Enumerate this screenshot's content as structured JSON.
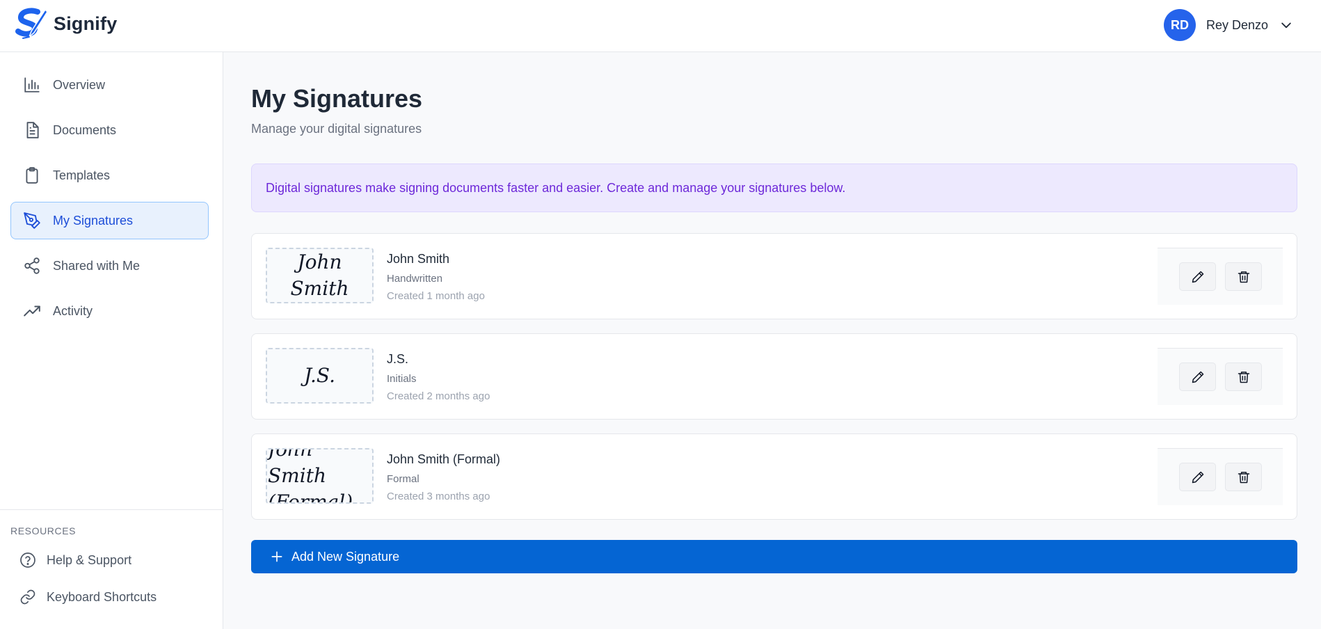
{
  "app": {
    "name": "Signify",
    "brand_color": "#1d63ed"
  },
  "user": {
    "initials": "RD",
    "name": "Rey Denzo"
  },
  "sidebar": {
    "items": [
      {
        "label": "Overview",
        "icon": "bar-chart-icon"
      },
      {
        "label": "Documents",
        "icon": "document-icon"
      },
      {
        "label": "Templates",
        "icon": "clipboard-icon"
      },
      {
        "label": "My Signatures",
        "icon": "pen-tool-icon",
        "active": true
      },
      {
        "label": "Shared with Me",
        "icon": "share-icon"
      },
      {
        "label": "Activity",
        "icon": "trending-up-icon"
      }
    ],
    "resources_label": "RESOURCES",
    "resources": [
      {
        "label": "Help & Support",
        "icon": "help-circle-icon"
      },
      {
        "label": "Keyboard Shortcuts",
        "icon": "link-icon"
      }
    ]
  },
  "main": {
    "title": "My Signatures",
    "subtitle": "Manage your digital signatures",
    "banner": "Digital signatures make signing documents faster and easier. Create and manage your signatures below.",
    "signatures": [
      {
        "preview": "John Smith",
        "name": "John Smith",
        "type": "Handwritten",
        "created": "Created 1 month ago"
      },
      {
        "preview": "J.S.",
        "name": "J.S.",
        "type": "Initials",
        "created": "Created 2 months ago"
      },
      {
        "preview": "John Smith (Formal)",
        "name": "John Smith (Formal)",
        "type": "Formal",
        "created": "Created 3 months ago"
      }
    ],
    "add_button": "Add New Signature"
  }
}
